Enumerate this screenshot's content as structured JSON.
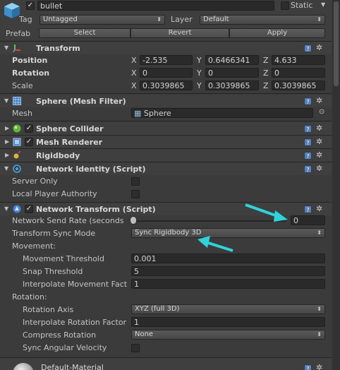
{
  "colors": {
    "accent_arrow": "#2fd3da",
    "panel": "#3b3b3b",
    "header": "#3f3f3f"
  },
  "object": {
    "name": "bullet",
    "static_label": "Static",
    "tag_label": "Tag",
    "tag_value": "Untagged",
    "layer_label": "Layer",
    "layer_value": "Default",
    "prefab_label": "Prefab",
    "prefab_buttons": [
      "Select",
      "Revert",
      "Apply"
    ]
  },
  "transform": {
    "title": "Transform",
    "position_label": "Position",
    "rotation_label": "Rotation",
    "scale_label": "Scale",
    "position": {
      "x": "-2.535",
      "y": "0.6466341",
      "z": "4.633"
    },
    "rotation": {
      "x": "0",
      "y": "0",
      "z": "0"
    },
    "scale": {
      "x": "0.3039865",
      "y": "0.3039865",
      "z": "0.3039865"
    },
    "axis_x": "X",
    "axis_y": "Y",
    "axis_z": "Z"
  },
  "mesh_filter": {
    "title": "Sphere (Mesh Filter)",
    "mesh_label": "Mesh",
    "mesh_value": "Sphere"
  },
  "components": {
    "sphere_collider": "Sphere Collider",
    "mesh_renderer": "Mesh Renderer",
    "rigidbody": "Rigidbody"
  },
  "network_identity": {
    "title": "Network Identity (Script)",
    "server_only": "Server Only",
    "local_player_authority": "Local Player Authority"
  },
  "network_transform": {
    "title": "Network Transform (Script)",
    "send_rate_label": "Network Send Rate (seconds",
    "send_rate_value": "0",
    "sync_mode_label": "Transform Sync Mode",
    "sync_mode_value": "Sync Rigidbody 3D",
    "movement_label": "Movement:",
    "movement_threshold_label": "Movement Threshold",
    "movement_threshold_value": "0.001",
    "snap_threshold_label": "Snap Threshold",
    "snap_threshold_value": "5",
    "interp_movement_label": "Interpolate Movement Fact",
    "interp_movement_value": "1",
    "rotation_label": "Rotation:",
    "rotation_axis_label": "Rotation Axis",
    "rotation_axis_value": "XYZ (full 3D)",
    "interp_rotation_label": "Interpolate Rotation Factor",
    "interp_rotation_value": "1",
    "compress_rotation_label": "Compress Rotation",
    "compress_rotation_value": "None",
    "sync_angular_label": "Sync Angular Velocity"
  },
  "material": {
    "name": "Default-Material"
  }
}
